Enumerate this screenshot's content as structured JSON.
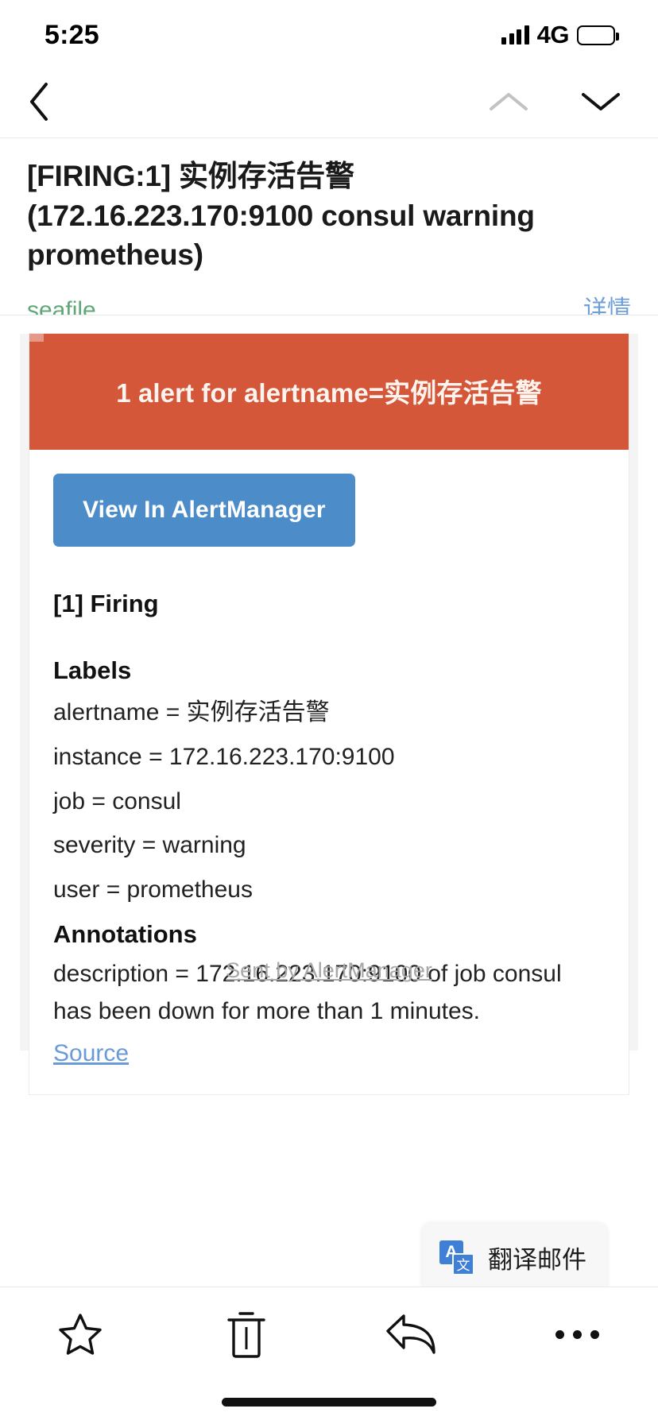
{
  "status_bar": {
    "time": "5:25",
    "network": "4G",
    "signal_icon": "signal-bars-icon",
    "battery_icon": "battery-icon"
  },
  "nav_bar": {
    "back_icon": "chevron-left-icon",
    "prev_icon": "chevron-up-icon",
    "next_icon": "chevron-down-icon"
  },
  "email": {
    "subject": "[FIRING:1] 实例存活告警 (172.16.223.170:9100 consul warning prometheus)",
    "sender": "seafile",
    "details_label": "详情"
  },
  "alert": {
    "banner_text": "1 alert for alertname=实例存活告警",
    "banner_color": "#d4573a",
    "button_label": "View In AlertManager",
    "button_color": "#4b8cc9",
    "firing_title": "[1] Firing",
    "labels_heading": "Labels",
    "labels": [
      "alertname = 实例存活告警",
      "instance = 172.16.223.170:9100",
      "job = consul",
      "severity = warning",
      "user = prometheus"
    ],
    "annotations_heading": "Annotations",
    "description": "description = 172.16.223.170:9100 of job consul has been down for more than 1 minutes.",
    "source_link": "Source",
    "footer": "Sent by AlertManager"
  },
  "translate": {
    "label": "翻译邮件",
    "icon": "translate-icon",
    "icon_letter": "A",
    "icon_glyph": "文"
  },
  "toolbar": {
    "favorite_icon": "star-icon",
    "delete_icon": "trash-icon",
    "reply_icon": "reply-arrow-icon",
    "more_icon": "more-dots-icon"
  }
}
